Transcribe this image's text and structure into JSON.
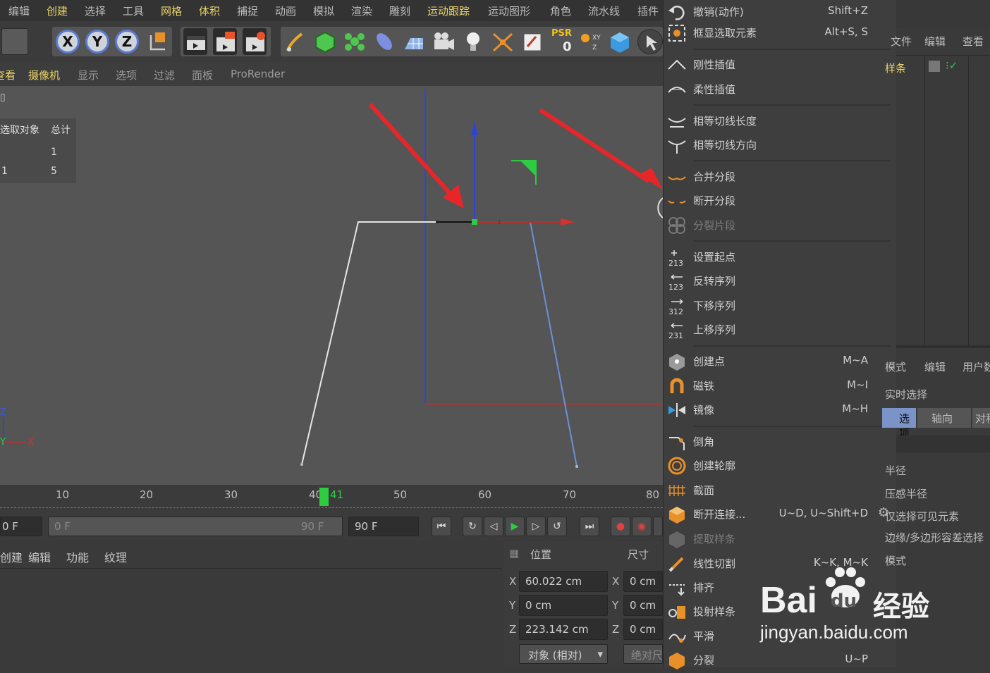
{
  "menubar": {
    "items": [
      "编辑",
      "创建",
      "选择",
      "工具",
      "网格",
      "体积",
      "捕捉",
      "动画",
      "模拟",
      "渲染",
      "雕刻",
      "运动跟踪",
      "运动图形",
      "角色",
      "流水线",
      "插件"
    ]
  },
  "toolbar": {
    "axis_x": "X",
    "axis_y": "Y",
    "axis_z": "Z",
    "psr_label": "PSR",
    "psr_value": "0"
  },
  "viewport_menu": {
    "items": [
      "查看",
      "摄像机",
      "显示",
      "选项",
      "过滤",
      "面板",
      "ProRender"
    ]
  },
  "stats": {
    "header_selected": "选取对象",
    "header_total": "总计",
    "row1_selected": "",
    "row1_total": "1",
    "row2_selected": "1",
    "row2_total": "5"
  },
  "axis_gizmo": {
    "x": "X",
    "y": "Y",
    "z": "Z"
  },
  "timeline": {
    "ticks": [
      "10",
      "20",
      "30",
      "40",
      "50",
      "60",
      "70",
      "80"
    ],
    "current_frame": "41"
  },
  "transport": {
    "start_field": "0 F",
    "range_start": "0 F",
    "range_end": "90 F",
    "end_field": "90 F"
  },
  "material_panel": {
    "tabs": [
      "创建",
      "编辑",
      "功能",
      "纹理"
    ]
  },
  "coords": {
    "position_label": "位置",
    "size_label": "尺寸",
    "x_label": "X",
    "y_label": "Y",
    "z_label": "Z",
    "pos_x": "60.022 cm",
    "pos_y": "0 cm",
    "pos_z": "223.142 cm",
    "size_x": "0 cm",
    "size_y": "0 cm",
    "size_z": "0 cm",
    "mode_button": "对象 (相对)",
    "abs_button": "绝对尺寸"
  },
  "context_menu": {
    "items": [
      {
        "label": "撤销(动作)",
        "shortcut": "Shift+Z"
      },
      {
        "label": "框显选取元素",
        "shortcut": "Alt+S, S"
      },
      {
        "label": "刚性插值",
        "shortcut": ""
      },
      {
        "label": "柔性插值",
        "shortcut": ""
      },
      {
        "label": "相等切线长度",
        "shortcut": ""
      },
      {
        "label": "相等切线方向",
        "shortcut": ""
      },
      {
        "label": "合并分段",
        "shortcut": ""
      },
      {
        "label": "断开分段",
        "shortcut": ""
      },
      {
        "label": "分裂片段",
        "shortcut": ""
      },
      {
        "label": "设置起点",
        "shortcut": ""
      },
      {
        "label": "反转序列",
        "shortcut": ""
      },
      {
        "label": "下移序列",
        "shortcut": ""
      },
      {
        "label": "上移序列",
        "shortcut": ""
      },
      {
        "label": "创建点",
        "shortcut": "M~A"
      },
      {
        "label": "磁铁",
        "shortcut": "M~I"
      },
      {
        "label": "镜像",
        "shortcut": "M~H"
      },
      {
        "label": "倒角",
        "shortcut": ""
      },
      {
        "label": "创建轮廓",
        "shortcut": ""
      },
      {
        "label": "截面",
        "shortcut": ""
      },
      {
        "label": "断开连接...",
        "shortcut": "U~D, U~Shift+D"
      },
      {
        "label": "提取样条",
        "shortcut": ""
      },
      {
        "label": "线性切割",
        "shortcut": "K~K, M~K"
      },
      {
        "label": "排齐",
        "shortcut": ""
      },
      {
        "label": "投射样条",
        "shortcut": ""
      },
      {
        "label": "平滑",
        "shortcut": ""
      },
      {
        "label": "分裂",
        "shortcut": "U~P"
      }
    ],
    "seq_icons": [
      "213",
      "123",
      "312",
      "231"
    ]
  },
  "right_panel": {
    "top_tabs": [
      "文件",
      "编辑",
      "查看"
    ],
    "object_name": "样条",
    "attr_tabs": [
      "模式",
      "编辑",
      "用户数据"
    ],
    "realtime_select": "实时选择",
    "tab_active": "选项",
    "tab_axis": "轴向",
    "tab_sym": "对称",
    "props": [
      "半径",
      "压感半径",
      "仅选择可见元素",
      "边缘/多边形容差选择",
      "模式"
    ]
  },
  "watermark": {
    "brand": "Bai",
    "brand2": "du",
    "jingyan": "经验",
    "url": "jingyan.baidu.com"
  },
  "colors": {
    "accent": "#e9d36a",
    "green": "#2ecc40",
    "red_arrow": "#e8262a",
    "axis_blue": "#2d45d6",
    "axis_red": "#d12a2a"
  }
}
